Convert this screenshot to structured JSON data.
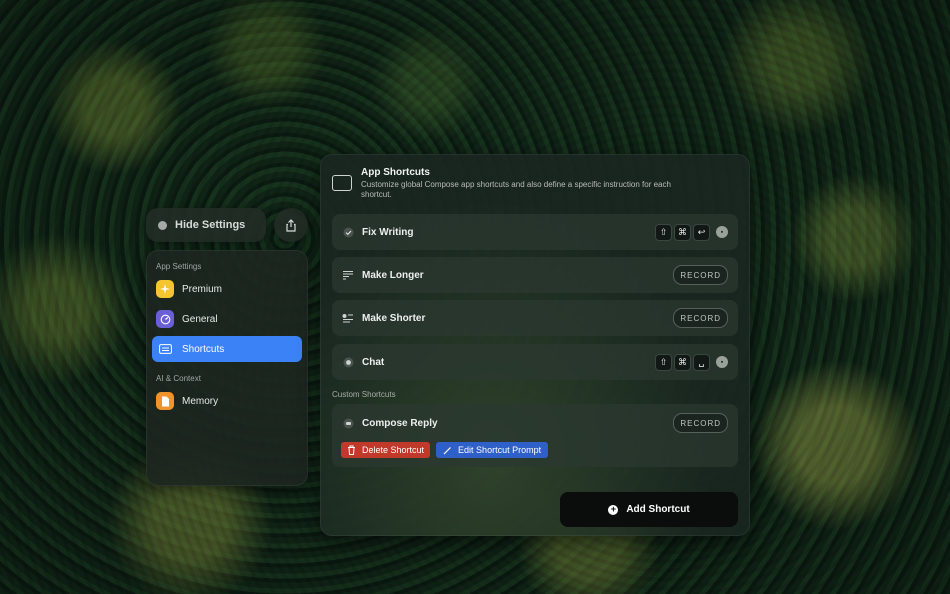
{
  "colors": {
    "accent": "#3b82f6",
    "delete": "#c0392b",
    "edit": "#2f5fc9"
  },
  "toolbar": {
    "hide_settings_label": "Hide Settings"
  },
  "sidebar": {
    "section_app": "App Settings",
    "items": [
      {
        "label": "Premium",
        "icon": "sparkle-icon"
      },
      {
        "label": "General",
        "icon": "gauge-icon"
      },
      {
        "label": "Shortcuts",
        "icon": "keyboard-icon"
      }
    ],
    "section_ai": "AI & Context",
    "ai_items": [
      {
        "label": "Memory",
        "icon": "document-icon"
      }
    ]
  },
  "panel": {
    "title": "App Shortcuts",
    "description": "Customize global Compose app shortcuts and also define a specific instruction for each shortcut.",
    "shortcuts": [
      {
        "label": "Fix Writing",
        "keys": [
          "⇧",
          "⌘",
          "↩"
        ]
      },
      {
        "label": "Make Longer",
        "record": "RECORD"
      },
      {
        "label": "Make Shorter",
        "record": "RECORD"
      },
      {
        "label": "Chat",
        "keys": [
          "⇧",
          "⌘",
          "␣"
        ]
      }
    ],
    "custom_label": "Custom Shortcuts",
    "custom": {
      "label": "Compose Reply",
      "record": "RECORD",
      "delete_label": "Delete Shortcut",
      "edit_label": "Edit Shortcut Prompt"
    },
    "add_label": "Add Shortcut"
  }
}
